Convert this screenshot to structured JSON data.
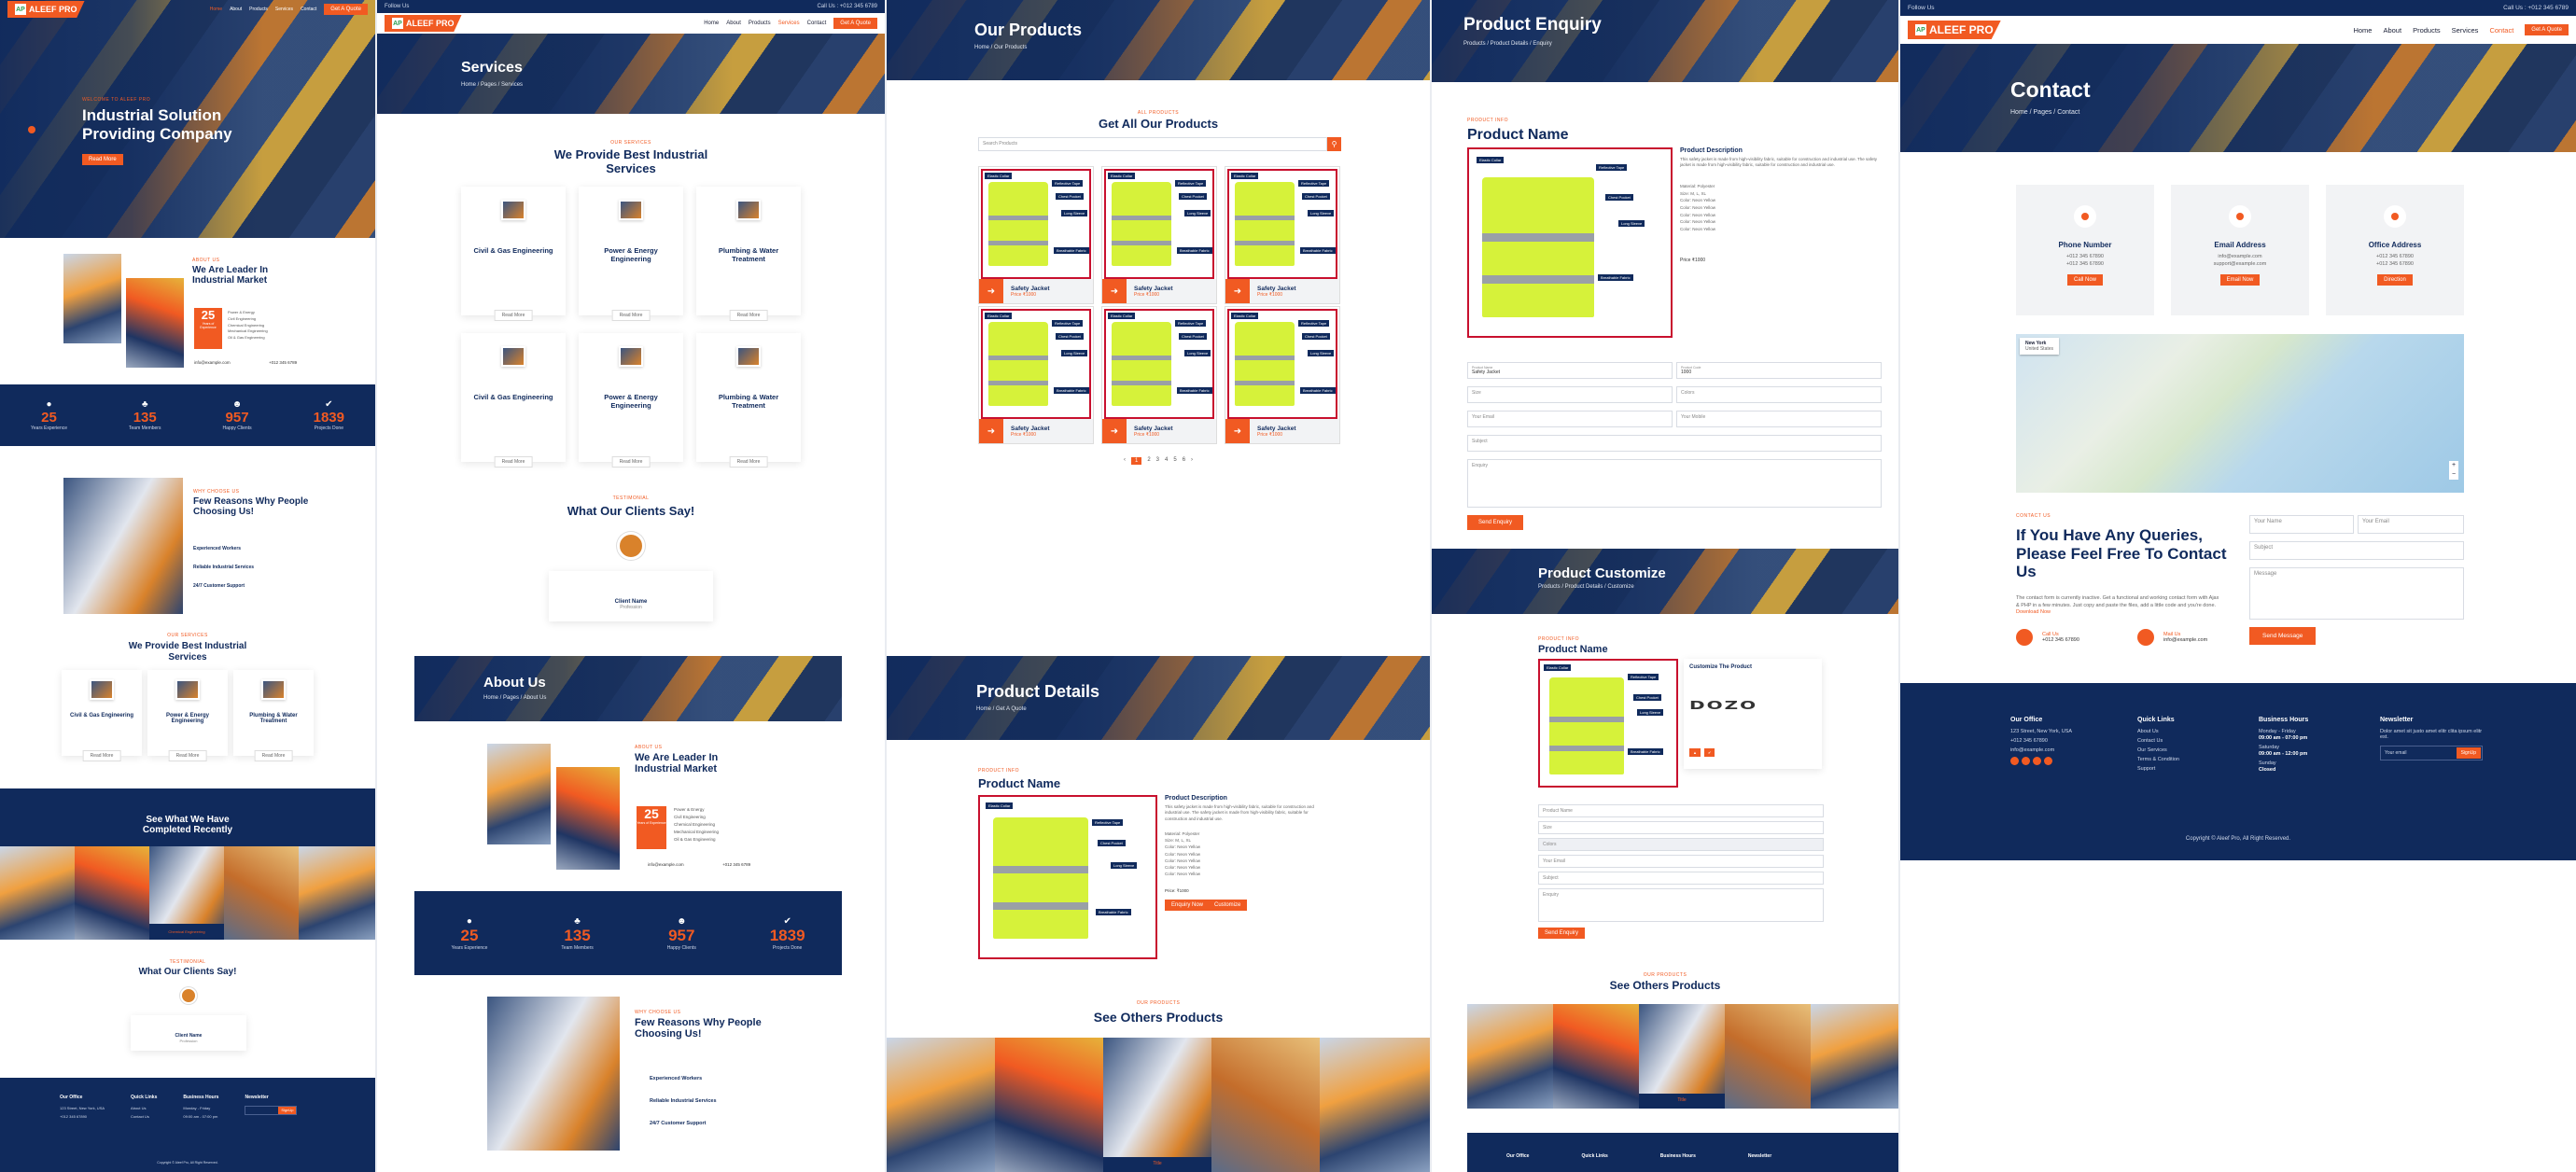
{
  "brand": {
    "name": "ALEEF PRO",
    "mark": "AP"
  },
  "nav": [
    "Home",
    "About",
    "Products",
    "Services",
    "Contact"
  ],
  "nav_cta": "Get A Quote",
  "topbar": {
    "follow": "Follow Us",
    "phone": "Call Us : +012 345 6789"
  },
  "home": {
    "hero_kicker": "WELCOME TO ALEEF PRO",
    "hero_title": "Industrial Solution Providing Company",
    "hero_btn": "Read More",
    "leader_kicker": "ABOUT US",
    "leader_title": "We Are Leader In Industrial Market",
    "years": "25",
    "years_label": "Years of Experience",
    "leader_list": [
      "Power & Energy",
      "Civil Engineering",
      "Chemical Engineering",
      "Mechanical Engineering",
      "Oil & Gas Engineering"
    ],
    "email": "info@example.com",
    "phone": "+012 345 6789",
    "stats": [
      {
        "n": "25",
        "l": "Years Experience",
        "i": "●"
      },
      {
        "n": "135",
        "l": "Team Members",
        "i": "♣"
      },
      {
        "n": "957",
        "l": "Happy Clients",
        "i": "☻"
      },
      {
        "n": "1839",
        "l": "Projects Done",
        "i": "✔"
      }
    ],
    "why_kicker": "WHY CHOOSE US",
    "why_title": "Few Reasons Why People Choosing Us!",
    "why_items": [
      "Experienced Workers",
      "Reliable Industrial Services",
      "24/7 Customer Support"
    ],
    "services_kicker": "OUR SERVICES",
    "services_title": "We Provide Best Industrial Services",
    "services": [
      "Civil & Gas Engineering",
      "Power & Energy Engineering",
      "Plumbing & Water Treatment"
    ],
    "read_more": "Read More",
    "projects_title": "See What We Have Completed Recently",
    "projects_caption": "Chemical Engineering",
    "testimonial_kicker": "TESTIMONIAL",
    "testimonial_title": "What Our Clients Say!",
    "client_name": "Client Name",
    "client_prof": "Profession"
  },
  "services_page": {
    "title": "Services",
    "crumb": "Home / Pages / Services",
    "kicker": "OUR SERVICES",
    "heading": "We Provide Best Industrial Services",
    "cards": [
      "Civil & Gas Engineering",
      "Power & Energy Engineering",
      "Plumbing & Water Treatment",
      "Civil & Gas Engineering",
      "Power & Energy Engineering",
      "Plumbing & Water Treatment"
    ],
    "read_more": "Read More",
    "testimonial_kicker": "TESTIMONIAL",
    "testimonial_title": "What Our Clients Say!",
    "client_name": "Client Name",
    "client_prof": "Profession"
  },
  "about_page": {
    "title": "About Us",
    "crumb": "Home / Pages / About Us",
    "leader_kicker": "ABOUT US",
    "leader_title": "We Are Leader In Industrial Market",
    "years": "25",
    "years_label": "Years of Experience",
    "list": [
      "Power & Energy",
      "Civil Engineering",
      "Chemical Engineering",
      "Mechanical Engineering",
      "Oil & Gas Engineering"
    ],
    "email": "info@example.com",
    "phone": "+012 345 6789",
    "why_kicker": "WHY CHOOSE US",
    "why_title": "Few Reasons Why People Choosing Us!",
    "why_items": [
      "Experienced Workers",
      "Reliable Industrial Services",
      "24/7 Customer Support"
    ]
  },
  "products_page": {
    "title": "Our Products",
    "crumb": "Home / Our Products",
    "kicker": "ALL PRODUCTS",
    "heading": "Get All Our Products",
    "search_placeholder": "Search Products",
    "product_name": "Safety Jacket",
    "product_price": "Price ₹1000",
    "pages": [
      "‹",
      "1",
      "2",
      "3",
      "4",
      "5",
      "6",
      "›"
    ],
    "tags": [
      "Elastic Collar",
      "Reflective Tape",
      "Chest Pocket",
      "Long Sleeve",
      "Breathable Fabric"
    ]
  },
  "details_page": {
    "title": "Product Details",
    "crumb": "Home / Get A Quote",
    "kicker": "PRODUCT INFO",
    "name": "Product Name",
    "desc_title": "Product Description",
    "desc": "This safety jacket is made from high-visibility fabric, suitable for construction and industrial use. The safety jacket is made from high-visibility fabric, suitable for construction and industrial use.",
    "bullets": [
      "Material: Polyester",
      "Size: M, L, XL",
      "Color: Neon Yellow",
      "Color: Neon Yellow",
      "Color: Neon Yellow",
      "Color: Neon Yellow",
      "Color: Neon Yellow"
    ],
    "price": "Price: ₹1000",
    "btn_enquiry": "Enquiry Now",
    "btn_customize": "Customize",
    "others_kicker": "OUR PRODUCTS",
    "others_title": "See Others Products",
    "others_caption": "Title"
  },
  "enquiry_page": {
    "title": "Product Enquiry",
    "crumb": "Products / Product Details / Enquiry",
    "kicker": "PRODUCT INFO",
    "name": "Product Name",
    "desc_title": "Product Description",
    "desc": "This safety jacket is made from high-visibility fabric, suitable for construction and industrial use. The safety jacket is made from high-visibility fabric, suitable for construction and industrial use.",
    "bullets": [
      "Material: Polyester",
      "Size: M, L, XL",
      "Color: Neon Yellow",
      "Color: Neon Yellow",
      "Color: Neon Yellow",
      "Color: Neon Yellow",
      "Color: Neon Yellow"
    ],
    "price": "Price ₹1000",
    "fields": [
      "Product Name",
      "Product Code",
      "Size",
      "Colors",
      "Your Email",
      "Your Mobile",
      "Subject",
      "Enquiry"
    ],
    "field_values": [
      "Safety Jacket",
      "1000"
    ],
    "submit": "Send Enquiry",
    "customize_title": "Product Customize",
    "customize_crumb": "Products / Product Details / Customize",
    "customize_box_title": "Customize The Product",
    "customize_logo": "DOZO",
    "others_kicker": "OUR PRODUCTS",
    "others_title": "See Others Products",
    "others_caption": "Title"
  },
  "contact_page": {
    "title": "Contact",
    "crumb": "Home / Pages / Contact",
    "cards": [
      {
        "t": "Phone Number",
        "l1": "+012 345 67890",
        "l2": "+012 345 67890",
        "b": "Call Now"
      },
      {
        "t": "Email Address",
        "l1": "info@example.com",
        "l2": "support@example.com",
        "b": "Email Now"
      },
      {
        "t": "Office Address",
        "l1": "+012 345 67890",
        "l2": "+012 345 67890",
        "b": "Direction"
      }
    ],
    "map_label": "New York",
    "map_sub": "United States",
    "kicker": "CONTACT US",
    "heading": "If You Have Any Queries, Please Feel Free To Contact Us",
    "body": "The contact form is currently inactive. Get a functional and working contact form with Ajax & PHP in a few minutes. Just copy and paste the files, add a little code and you're done.",
    "link": "Download Now",
    "call_label": "Call Us",
    "call_val": "+012 345 67890",
    "mail_label": "Mail Us",
    "mail_val": "info@example.com",
    "placeholders": [
      "Your Name",
      "Your Email",
      "Subject",
      "Message"
    ],
    "send": "Send Message"
  },
  "footer": {
    "office_title": "Our Office",
    "office": [
      "123 Street, New York, USA",
      "+012 345 67890",
      "info@example.com"
    ],
    "links_title": "Quick Links",
    "links": [
      "About Us",
      "Contact Us",
      "Our Services",
      "Terms & Condition",
      "Support"
    ],
    "hours_title": "Business Hours",
    "hours": [
      "Monday - Friday",
      "09:00 am - 07:00 pm",
      "Saturday",
      "09:00 am - 12:00 pm",
      "Sunday",
      "Closed"
    ],
    "news_title": "Newsletter",
    "news_text": "Dolor amet sit justo amet elitr clita ipsum elitr est.",
    "news_placeholder": "Your email",
    "news_btn": "SignUp",
    "copyright": "Copyright © Aleef Pro, All Right Reserved."
  }
}
